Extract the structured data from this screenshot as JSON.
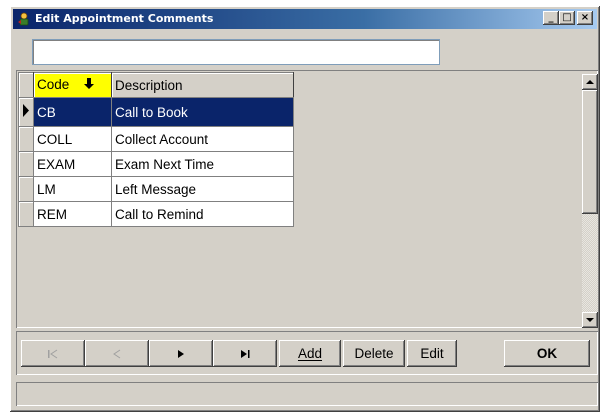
{
  "window": {
    "title": "Edit Appointment Comments",
    "controls": {
      "minimize": "_",
      "maximize": "□",
      "close": "×"
    }
  },
  "filter": {
    "value": "",
    "placeholder": ""
  },
  "grid": {
    "columns": [
      "Code",
      "Description"
    ],
    "sort": {
      "column": "Code",
      "direction": "down-arrow-icon"
    },
    "rows": [
      {
        "code": "CB",
        "description": "Call to Book"
      },
      {
        "code": "COLL",
        "description": "Collect Account"
      },
      {
        "code": "EXAM",
        "description": "Exam Next Time"
      },
      {
        "code": "LM",
        "description": "Left Message"
      },
      {
        "code": "REM",
        "description": "Call to Remind"
      }
    ],
    "selected_row_index": 0,
    "colors": {
      "header_highlight": "#ffff00",
      "selection": "#0a246a"
    }
  },
  "toolbar": {
    "first_icon": "first-record-icon",
    "prev_icon": "previous-record-icon",
    "next_icon": "next-record-icon",
    "last_icon": "last-record-icon",
    "add_label": "Add",
    "delete_label": "Delete",
    "edit_label": "Edit",
    "ok_label": "OK"
  },
  "status": {
    "text": ""
  }
}
